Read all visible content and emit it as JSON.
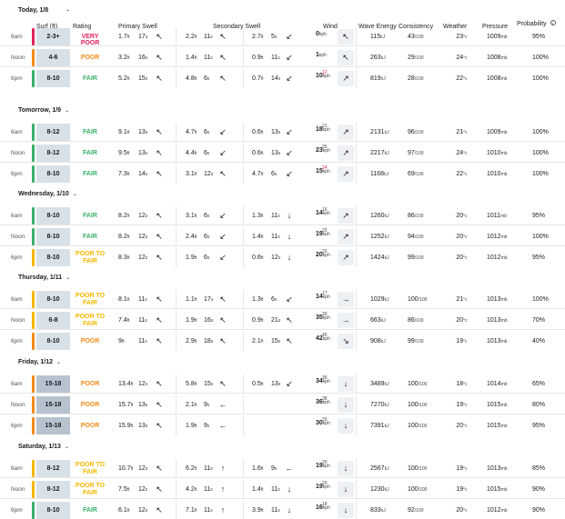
{
  "header": {
    "today": "Today, 1/8",
    "cols": {
      "surf": "Surf (ft)",
      "rating": "Rating",
      "primary": "Primary Swell",
      "secondary": "Secondary Swell",
      "wind": "Wind",
      "energy": "Wave Energy",
      "consistency": "Consistency",
      "weather": "Weather",
      "pressure": "Pressure",
      "probability": "Probability"
    },
    "info_icon_char": "i"
  },
  "colors": {
    "very_poor": "#e0245e",
    "poor": "#f28c1b",
    "poor_to_fair": "#f5b800",
    "fair": "#3ab06a",
    "surf_bg": "#d8e1e8",
    "surf_bg_dark": "#b6c3cf"
  },
  "days": [
    {
      "label": "Today, 1/8",
      "rows": [
        {
          "time": "6am",
          "surf": "2-3+",
          "rating": "VERY POOR",
          "level": "very_poor",
          "p1": [
            "1.7",
            "17"
          ],
          "p1dir": "↖",
          "s1": [
            "2.2",
            "11"
          ],
          "s1dir": "↖",
          "s2": [
            "2.7",
            "5"
          ],
          "s2dir": "↙",
          "wind": "0",
          "gust": "",
          "winddir": "↖",
          "energy": "115",
          "cons": "43",
          "weather": "23",
          "pres": "1009",
          "prob": "95%"
        },
        {
          "time": "Noon",
          "surf": "4-6",
          "rating": "POOR",
          "level": "poor",
          "p1": [
            "3.2",
            "16"
          ],
          "p1dir": "↖",
          "s1": [
            "1.4",
            "11"
          ],
          "s1dir": "↖",
          "s2": [
            "0.9",
            "11"
          ],
          "s2dir": "↙",
          "wind": "1",
          "gust": "",
          "winddir": "↖",
          "energy": "263",
          "cons": "29",
          "weather": "24",
          "pres": "1008",
          "prob": "100%"
        },
        {
          "time": "6pm",
          "surf": "8-10",
          "rating": "FAIR",
          "level": "fair",
          "p1": [
            "5.2",
            "15"
          ],
          "p1dir": "↖",
          "s1": [
            "4.8",
            "6"
          ],
          "s1dir": "↖",
          "s2": [
            "0.7",
            "14"
          ],
          "s2dir": "↙",
          "wind": "10",
          "gust": "12",
          "winddir": "↗",
          "energy": "819",
          "cons": "28",
          "weather": "22",
          "pres": "1008",
          "prob": "100%"
        }
      ]
    },
    {
      "label": "Tomorrow, 1/9",
      "rows": [
        {
          "time": "6am",
          "surf": "8-12",
          "rating": "FAIR",
          "level": "fair",
          "p1": [
            "9.1",
            "13"
          ],
          "p1dir": "↖",
          "s1": [
            "4.7",
            "6"
          ],
          "s1dir": "↙",
          "s2": [
            "0.6",
            "13"
          ],
          "s2dir": "↙",
          "wind": "18",
          "gust": "21",
          "winddir": "↗",
          "energy": "2131",
          "cons": "96",
          "weather": "21",
          "pres": "1009",
          "prob": "100%"
        },
        {
          "time": "Noon",
          "surf": "8-12",
          "rating": "FAIR",
          "level": "fair",
          "p1": [
            "9.5",
            "13"
          ],
          "p1dir": "↖",
          "s1": [
            "4.4",
            "6"
          ],
          "s1dir": "↙",
          "s2": [
            "0.6",
            "13"
          ],
          "s2dir": "↙",
          "wind": "23",
          "gust": "25",
          "winddir": "↗",
          "energy": "2217",
          "cons": "97",
          "weather": "24",
          "pres": "1010",
          "prob": "100%"
        },
        {
          "time": "6pm",
          "surf": "8-10",
          "rating": "FAIR",
          "level": "fair",
          "p1": [
            "7.3",
            "14"
          ],
          "p1dir": "↖",
          "s1": [
            "3.1",
            "12"
          ],
          "s1dir": "↖",
          "s2": [
            "4.7",
            "6"
          ],
          "s2dir": "↙",
          "wind": "15",
          "gust": "24",
          "winddir": "↗",
          "energy": "1168",
          "cons": "69",
          "weather": "22",
          "pres": "1010",
          "prob": "100%"
        }
      ]
    },
    {
      "label": "Wednesday, 1/10",
      "rows": [
        {
          "time": "6am",
          "surf": "8-10",
          "rating": "FAIR",
          "level": "fair",
          "p1": [
            "8.2",
            "12"
          ],
          "p1dir": "↖",
          "s1": [
            "3.1",
            "6"
          ],
          "s1dir": "↙",
          "s2": [
            "1.3",
            "11"
          ],
          "s2dir": "↓",
          "wind": "14",
          "gust": "16",
          "winddir": "↗",
          "energy": "1260",
          "cons": "86",
          "weather": "20",
          "pres": "1011",
          "prob": "95%"
        },
        {
          "time": "Noon",
          "surf": "8-10",
          "rating": "FAIR",
          "level": "fair",
          "p1": [
            "8.2",
            "12"
          ],
          "p1dir": "↖",
          "s1": [
            "2.4",
            "6"
          ],
          "s1dir": "↙",
          "s2": [
            "1.4",
            "11"
          ],
          "s2dir": "↓",
          "wind": "19",
          "gust": "22",
          "winddir": "↗",
          "energy": "1252",
          "cons": "94",
          "weather": "20",
          "pres": "1012",
          "prob": "100%"
        },
        {
          "time": "6pm",
          "surf": "8-10",
          "rating": "POOR TO FAIR",
          "level": "poor_to_fair",
          "p1": [
            "8.3",
            "12"
          ],
          "p1dir": "↖",
          "s1": [
            "1.9",
            "6"
          ],
          "s1dir": "↙",
          "s2": [
            "0.6",
            "12"
          ],
          "s2dir": "↓",
          "wind": "20",
          "gust": "22",
          "winddir": "↗",
          "energy": "1424",
          "cons": "99",
          "weather": "20",
          "pres": "1012",
          "prob": "95%"
        }
      ]
    },
    {
      "label": "Thursday, 1/11",
      "rows": [
        {
          "time": "6am",
          "surf": "8-10",
          "rating": "POOR TO FAIR",
          "level": "poor_to_fair",
          "p1": [
            "8.1",
            "11"
          ],
          "p1dir": "↖",
          "s1": [
            "1.1",
            "17"
          ],
          "s1dir": "↖",
          "s2": [
            "1.3",
            "6"
          ],
          "s2dir": "↙",
          "wind": "14",
          "gust": "17",
          "winddir": "→",
          "energy": "1029",
          "cons": "100",
          "weather": "21",
          "pres": "1013",
          "prob": "100%"
        },
        {
          "time": "Noon",
          "surf": "6-8",
          "rating": "POOR TO FAIR",
          "level": "poor_to_fair",
          "p1": [
            "7.4",
            "11"
          ],
          "p1dir": "↖",
          "s1": [
            "1.9",
            "16"
          ],
          "s1dir": "↖",
          "s2": [
            "0.9",
            "21"
          ],
          "s2dir": "↖",
          "wind": "35",
          "gust": "39",
          "winddir": "→",
          "energy": "663",
          "cons": "86",
          "weather": "20",
          "pres": "1013",
          "prob": "70%"
        },
        {
          "time": "6pm",
          "surf": "8-10",
          "rating": "POOR",
          "level": "poor",
          "p1": [
            "9",
            "11"
          ],
          "p1dir": "↖",
          "s1": [
            "2.9",
            "18"
          ],
          "s1dir": "↖",
          "s2": [
            "2.1",
            "15"
          ],
          "s2dir": "↖",
          "wind": "42",
          "gust": "45",
          "winddir": "↘",
          "energy": "908",
          "cons": "99",
          "weather": "19",
          "pres": "1013",
          "prob": "40%"
        }
      ]
    },
    {
      "label": "Friday, 1/12",
      "rows": [
        {
          "time": "6am",
          "surf": "15-18",
          "rating": "POOR",
          "level": "poor",
          "p1": [
            "13.4",
            "12"
          ],
          "p1dir": "↖",
          "s1": [
            "5.8",
            "15"
          ],
          "s1dir": "↖",
          "s2": [
            "0.5",
            "13"
          ],
          "s2dir": "↙",
          "wind": "34",
          "gust": "36",
          "winddir": "↓",
          "energy": "3489",
          "cons": "100",
          "weather": "18",
          "pres": "1014",
          "prob": "65%"
        },
        {
          "time": "Noon",
          "surf": "15-18",
          "rating": "POOR",
          "level": "poor",
          "p1": [
            "15.7",
            "13"
          ],
          "p1dir": "↖",
          "s1": [
            "2.1",
            "9"
          ],
          "s1dir": "←",
          "s2": [
            "",
            ""
          ],
          "s2dir": "",
          "wind": "36",
          "gust": "38",
          "winddir": "↓",
          "energy": "7270",
          "cons": "100",
          "weather": "19",
          "pres": "1015",
          "prob": "80%"
        },
        {
          "time": "6pm",
          "surf": "15-18",
          "rating": "POOR",
          "level": "poor",
          "p1": [
            "15.9",
            "13"
          ],
          "p1dir": "↖",
          "s1": [
            "1.9",
            "9"
          ],
          "s1dir": "←",
          "s2": [
            "",
            ""
          ],
          "s2dir": "",
          "wind": "30",
          "gust": "33",
          "winddir": "↓",
          "energy": "7391",
          "cons": "100",
          "weather": "20",
          "pres": "1015",
          "prob": "95%"
        }
      ]
    },
    {
      "label": "Saturday, 1/13",
      "rows": [
        {
          "time": "6am",
          "surf": "8-12",
          "rating": "POOR TO FAIR",
          "level": "poor_to_fair",
          "p1": [
            "10.7",
            "12"
          ],
          "p1dir": "↖",
          "s1": [
            "6.2",
            "11"
          ],
          "s1dir": "↑",
          "s2": [
            "1.6",
            "9"
          ],
          "s2dir": "←",
          "wind": "19",
          "gust": "20",
          "winddir": "↓",
          "energy": "2567",
          "cons": "100",
          "weather": "19",
          "pres": "1013",
          "prob": "85%"
        },
        {
          "time": "Noon",
          "surf": "8-12",
          "rating": "POOR TO FAIR",
          "level": "poor_to_fair",
          "p1": [
            "7.5",
            "12"
          ],
          "p1dir": "↖",
          "s1": [
            "4.2",
            "11"
          ],
          "s1dir": "↑",
          "s2": [
            "1.4",
            "11"
          ],
          "s2dir": "↓",
          "wind": "19",
          "gust": "20",
          "winddir": "↓",
          "energy": "1230",
          "cons": "100",
          "weather": "19",
          "pres": "1015",
          "prob": "90%"
        },
        {
          "time": "6pm",
          "surf": "8-10",
          "rating": "FAIR",
          "level": "fair",
          "p1": [
            "6.1",
            "12"
          ],
          "p1dir": "↖",
          "s1": [
            "7.1",
            "11"
          ],
          "s1dir": "↑",
          "s2": [
            "3.9",
            "11"
          ],
          "s2dir": "↓",
          "wind": "16",
          "gust": "18",
          "winddir": "↓",
          "energy": "833",
          "cons": "92",
          "weather": "20",
          "pres": "1012",
          "prob": "90%"
        }
      ]
    }
  ],
  "units": {
    "ft": "ft",
    "s": "s",
    "kph": "kph",
    "kj": "kJ",
    "per100": "/100",
    "deg": "°c",
    "mb": "mb"
  }
}
